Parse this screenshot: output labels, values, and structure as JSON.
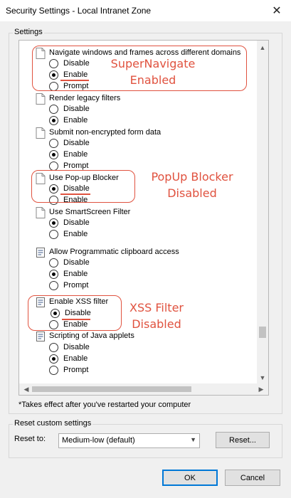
{
  "window": {
    "title": "Security Settings - Local Intranet Zone",
    "close_glyph": "✕"
  },
  "settings_group": {
    "label": "Settings"
  },
  "items": [
    {
      "label": "Navigate windows and frames across different domains",
      "icon": "document-icon",
      "options": [
        {
          "label": "Disable",
          "checked": false
        },
        {
          "label": "Enable",
          "checked": true
        },
        {
          "label": "Prompt",
          "checked": false
        }
      ]
    },
    {
      "label": "Render legacy filters",
      "icon": "document-icon",
      "options": [
        {
          "label": "Disable",
          "checked": false
        },
        {
          "label": "Enable",
          "checked": true
        }
      ]
    },
    {
      "label": "Submit non-encrypted form data",
      "icon": "document-icon",
      "options": [
        {
          "label": "Disable",
          "checked": false
        },
        {
          "label": "Enable",
          "checked": true
        },
        {
          "label": "Prompt",
          "checked": false
        }
      ]
    },
    {
      "label": "Use Pop-up Blocker",
      "icon": "document-icon",
      "options": [
        {
          "label": "Disable",
          "checked": true
        },
        {
          "label": "Enable",
          "checked": false
        }
      ]
    },
    {
      "label": "Use SmartScreen Filter",
      "icon": "document-icon",
      "options": [
        {
          "label": "Disable",
          "checked": true
        },
        {
          "label": "Enable",
          "checked": false
        }
      ]
    },
    {
      "label": "Allow Programmatic clipboard access",
      "icon": "script-icon",
      "options": [
        {
          "label": "Disable",
          "checked": false
        },
        {
          "label": "Enable",
          "checked": true
        },
        {
          "label": "Prompt",
          "checked": false
        }
      ]
    },
    {
      "label": "Enable XSS filter",
      "icon": "script-icon",
      "options": [
        {
          "label": "Disable",
          "checked": true
        },
        {
          "label": "Enable",
          "checked": false
        }
      ]
    },
    {
      "label": "Scripting of Java applets",
      "icon": "script-icon",
      "options": [
        {
          "label": "Disable",
          "checked": false
        },
        {
          "label": "Enable",
          "checked": true
        },
        {
          "label": "Prompt",
          "checked": false
        }
      ]
    }
  ],
  "annotations": {
    "supernavigate": [
      "SuperNavigate",
      "Enabled"
    ],
    "popup": [
      "PopUp Blocker",
      "Disabled"
    ],
    "xss": [
      "XSS Filter",
      "Disabled"
    ],
    "color": "#e0523f"
  },
  "restart_note": "*Takes effect after you've restarted your computer",
  "reset_group": {
    "label": "Reset custom settings",
    "reset_to_label": "Reset to:",
    "select_value": "Medium-low (default)",
    "reset_button": "Reset..."
  },
  "footer": {
    "ok": "OK",
    "cancel": "Cancel"
  }
}
